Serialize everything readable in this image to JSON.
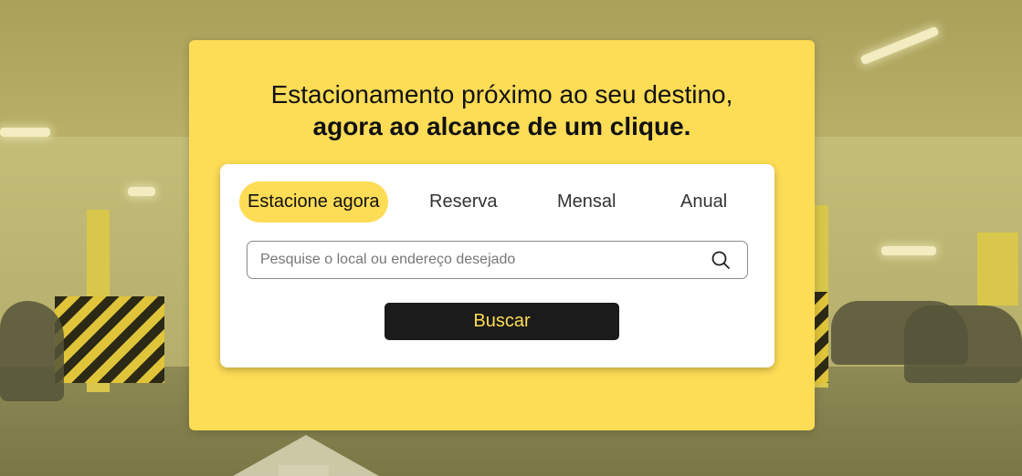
{
  "hero": {
    "headline_line1": "Estacionamento próximo ao seu destino,",
    "headline_line2": "agora ao alcance de um clique."
  },
  "tabs": [
    {
      "label": "Estacione agora",
      "active": true
    },
    {
      "label": "Reserva",
      "active": false
    },
    {
      "label": "Mensal",
      "active": false
    },
    {
      "label": "Anual",
      "active": false
    }
  ],
  "search": {
    "placeholder": "Pesquise o local ou endereço desejado",
    "value": "",
    "icon": "search-icon"
  },
  "actions": {
    "submit_label": "Buscar"
  },
  "colors": {
    "brand_yellow": "#fddc56",
    "button_dark": "#1b1b1b",
    "panel_white": "#ffffff"
  }
}
